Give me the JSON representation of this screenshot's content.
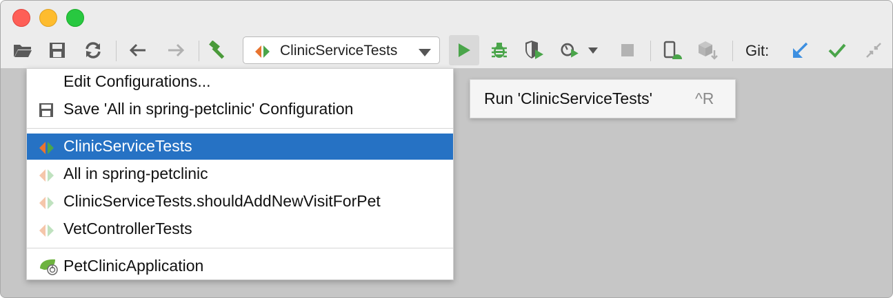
{
  "toolbar": {
    "run_config_label": "ClinicServiceTests",
    "git_label": "Git:"
  },
  "menu": {
    "items": [
      {
        "label": "Edit Configurations...",
        "icon": "none"
      },
      {
        "label": "Save 'All in spring-petclinic' Configuration",
        "icon": "save-icon"
      },
      {
        "label": "ClinicServiceTests",
        "icon": "test-config-icon",
        "selected": true
      },
      {
        "label": "All in spring-petclinic",
        "icon": "test-config-faded-icon"
      },
      {
        "label": "ClinicServiceTests.shouldAddNewVisitForPet",
        "icon": "test-config-faded-icon"
      },
      {
        "label": "VetControllerTests",
        "icon": "test-config-faded-icon"
      },
      {
        "label": "PetClinicApplication",
        "icon": "spring-boot-icon"
      }
    ]
  },
  "tooltip": {
    "text": "Run 'ClinicServiceTests'",
    "shortcut": "^R"
  },
  "colors": {
    "selection": "#2672c4",
    "run_green": "#4aa54a",
    "git_blue": "#3d8fe0",
    "test_orange": "#e8742f"
  }
}
